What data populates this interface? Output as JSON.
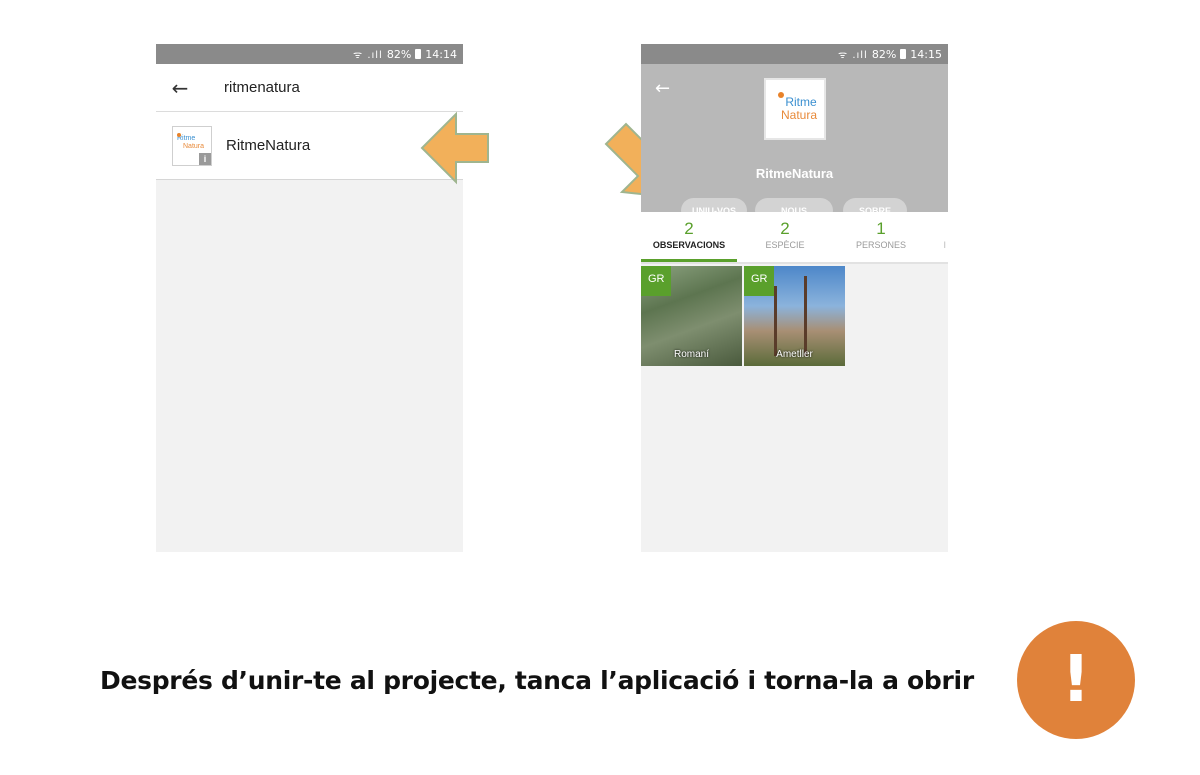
{
  "status_left": {
    "signal": "ᯤ .ıll",
    "battery_pct": "82%",
    "time": "14:14"
  },
  "status_right": {
    "signal": "ᯤ .ıll",
    "battery_pct": "82%",
    "time": "14:15"
  },
  "search": {
    "back": "←",
    "query": "ritmenatura"
  },
  "result": {
    "logo_line1": "Ritme",
    "logo_line2": "Natura",
    "info": "i",
    "name": "RitmeNatura"
  },
  "project": {
    "back": "←",
    "logo_line1": "Ritme",
    "logo_line2": "Natura",
    "name": "RitmeNatura",
    "buttons": [
      "UNIU-VOS",
      "NOUS",
      "SOBRE"
    ],
    "tabs": [
      {
        "count": "2",
        "label": "OBSERVACIONS"
      },
      {
        "count": "2",
        "label": "ESPÈCIE"
      },
      {
        "count": "1",
        "label": "PERSONES"
      }
    ],
    "tab_overflow": "I",
    "observations": [
      {
        "badge": "GR",
        "caption": "Romaní"
      },
      {
        "badge": "GR",
        "caption": "Ametller"
      }
    ]
  },
  "message": "Després d’unir-te al projecte, tanca l’aplicació i torna-la a obrir",
  "alert_symbol": "!",
  "colors": {
    "accent_green": "#5aa02c",
    "arrow_orange": "#f2b05a",
    "alert_orange": "#e0823a"
  }
}
